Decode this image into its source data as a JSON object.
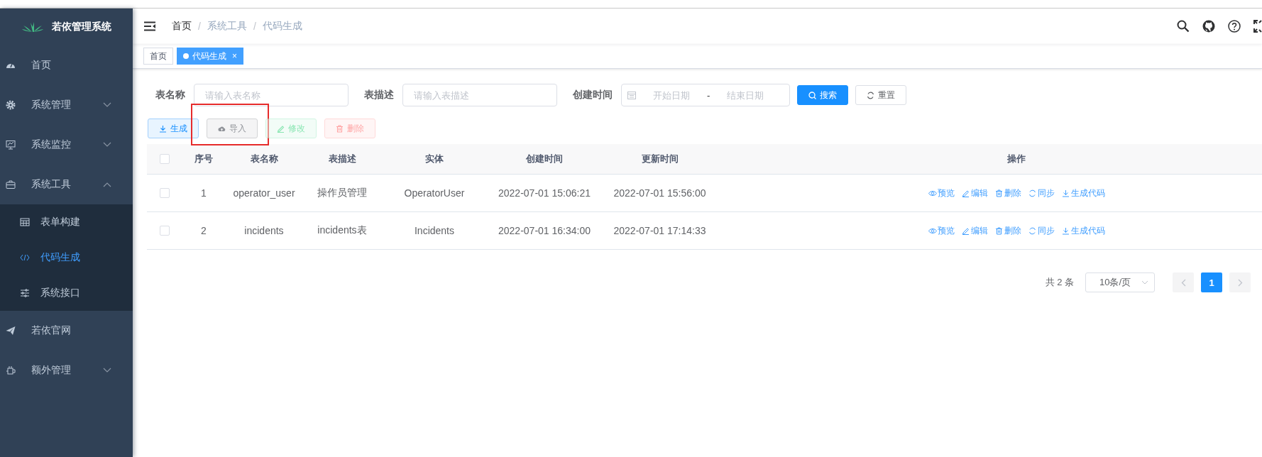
{
  "sidebar": {
    "title": "若依管理系统",
    "items": [
      {
        "label": "首页"
      },
      {
        "label": "系统管理",
        "expanded": false
      },
      {
        "label": "系统监控",
        "expanded": false
      },
      {
        "label": "系统工具",
        "expanded": true,
        "children": [
          {
            "label": "表单构建",
            "selected": false
          },
          {
            "label": "代码生成",
            "selected": true
          },
          {
            "label": "系统接口",
            "selected": false
          }
        ]
      },
      {
        "label": "若依官网"
      },
      {
        "label": "额外管理",
        "expanded": false
      }
    ]
  },
  "breadcrumb": {
    "items": [
      "首页",
      "系统工具",
      "代码生成"
    ],
    "separators": [
      "/",
      "/"
    ]
  },
  "tags": [
    {
      "label": "首页",
      "selected": false
    },
    {
      "label": "代码生成",
      "selected": true,
      "close": "×"
    }
  ],
  "search_form": {
    "fields": [
      {
        "label": "表名称",
        "placeholder": "请输入表名称"
      },
      {
        "label": "表描述",
        "placeholder": "请输入表描述"
      }
    ],
    "date_range": {
      "label": "创建时间",
      "start_placeholder": "开始日期",
      "separator": "-",
      "end_placeholder": "结束日期"
    },
    "search_button": "搜索",
    "reset_button": "重置"
  },
  "toolbar": [
    {
      "label": "生成",
      "kind": "primary",
      "disabled": false,
      "highlighted": false
    },
    {
      "label": "导入",
      "kind": "info",
      "disabled": false,
      "highlighted": true
    },
    {
      "label": "修改",
      "kind": "success",
      "disabled": true,
      "highlighted": false
    },
    {
      "label": "删除",
      "kind": "danger",
      "disabled": true,
      "highlighted": false
    }
  ],
  "table": {
    "header_checked": false,
    "columns": [
      "序号",
      "表名称",
      "表描述",
      "实体",
      "创建时间",
      "更新时间",
      "操作"
    ],
    "rows": [
      {
        "checked": false,
        "cells": [
          "1",
          "operator_user",
          "操作员管理",
          "OperatorUser",
          "2022-07-01 15:06:21",
          "2022-07-01 15:56:00"
        ],
        "actions": [
          "预览",
          "编辑",
          "删除",
          "同步",
          "生成代码"
        ]
      },
      {
        "checked": false,
        "cells": [
          "2",
          "incidents",
          "incidents表",
          "Incidents",
          "2022-07-01 16:34:00",
          "2022-07-01 17:14:33"
        ],
        "actions": [
          "预览",
          "编辑",
          "删除",
          "同步",
          "生成代码"
        ]
      }
    ]
  },
  "pagination": {
    "total": "共 2 条",
    "page_size": "10条/页",
    "pages": [
      {
        "label": "1",
        "selected": true
      }
    ]
  }
}
